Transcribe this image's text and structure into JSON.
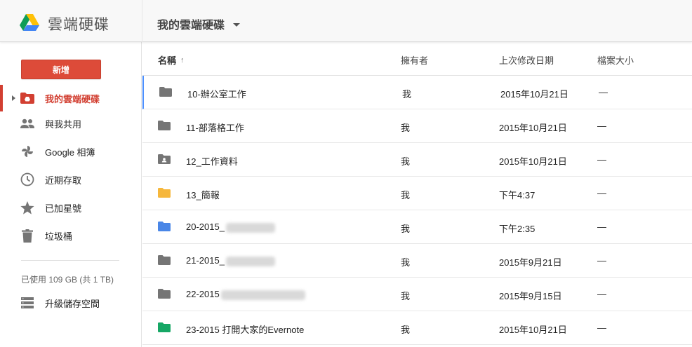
{
  "header": {
    "app_title": "雲端硬碟",
    "location": "我的雲端硬碟"
  },
  "sidebar": {
    "new_button": "新增",
    "items": [
      {
        "label": "我的雲端硬碟",
        "icon": "drive-folder-icon",
        "active": true
      },
      {
        "label": "與我共用",
        "icon": "people-icon"
      },
      {
        "label": "Google 相簿",
        "icon": "photos-pinwheel-icon"
      },
      {
        "label": "近期存取",
        "icon": "clock-icon"
      },
      {
        "label": "已加星號",
        "icon": "star-icon"
      },
      {
        "label": "垃圾桶",
        "icon": "trash-icon"
      }
    ],
    "storage_text": "已使用 109 GB (共 1 TB)",
    "upgrade_label": "升級儲存空間"
  },
  "columns": {
    "name": "名稱",
    "sort_indicator": "↑",
    "owner": "擁有者",
    "modified": "上次修改日期",
    "size": "檔案大小"
  },
  "files": [
    {
      "name": "10-辦公室工作",
      "owner": "我",
      "modified": "2015年10月21日",
      "size": "—",
      "icon": "folder-icon",
      "color": "#757575"
    },
    {
      "name": "11-部落格工作",
      "owner": "我",
      "modified": "2015年10月21日",
      "size": "—",
      "icon": "folder-icon",
      "color": "#757575"
    },
    {
      "name": "12_工作資料",
      "owner": "我",
      "modified": "2015年10月21日",
      "size": "—",
      "icon": "shared-folder-icon",
      "color": "#757575"
    },
    {
      "name": "13_簡報",
      "owner": "我",
      "modified": "下午4:37",
      "size": "—",
      "icon": "folder-icon",
      "color": "#f6b73c"
    },
    {
      "name": "20-2015_",
      "owner": "我",
      "modified": "下午2:35",
      "size": "—",
      "icon": "folder-icon",
      "color": "#4986e7"
    },
    {
      "name": "21-2015_",
      "owner": "我",
      "modified": "2015年9月21日",
      "size": "—",
      "icon": "folder-icon",
      "color": "#757575"
    },
    {
      "name": "22-2015",
      "owner": "我",
      "modified": "2015年9月15日",
      "size": "—",
      "icon": "folder-icon",
      "color": "#757575"
    },
    {
      "name": "23-2015 打開大家的Evernote",
      "owner": "我",
      "modified": "2015年10月21日",
      "size": "—",
      "icon": "folder-icon",
      "color": "#16a765"
    }
  ],
  "colors": {
    "accent_red": "#dd4b39",
    "selection_blue": "#4d90fe"
  }
}
